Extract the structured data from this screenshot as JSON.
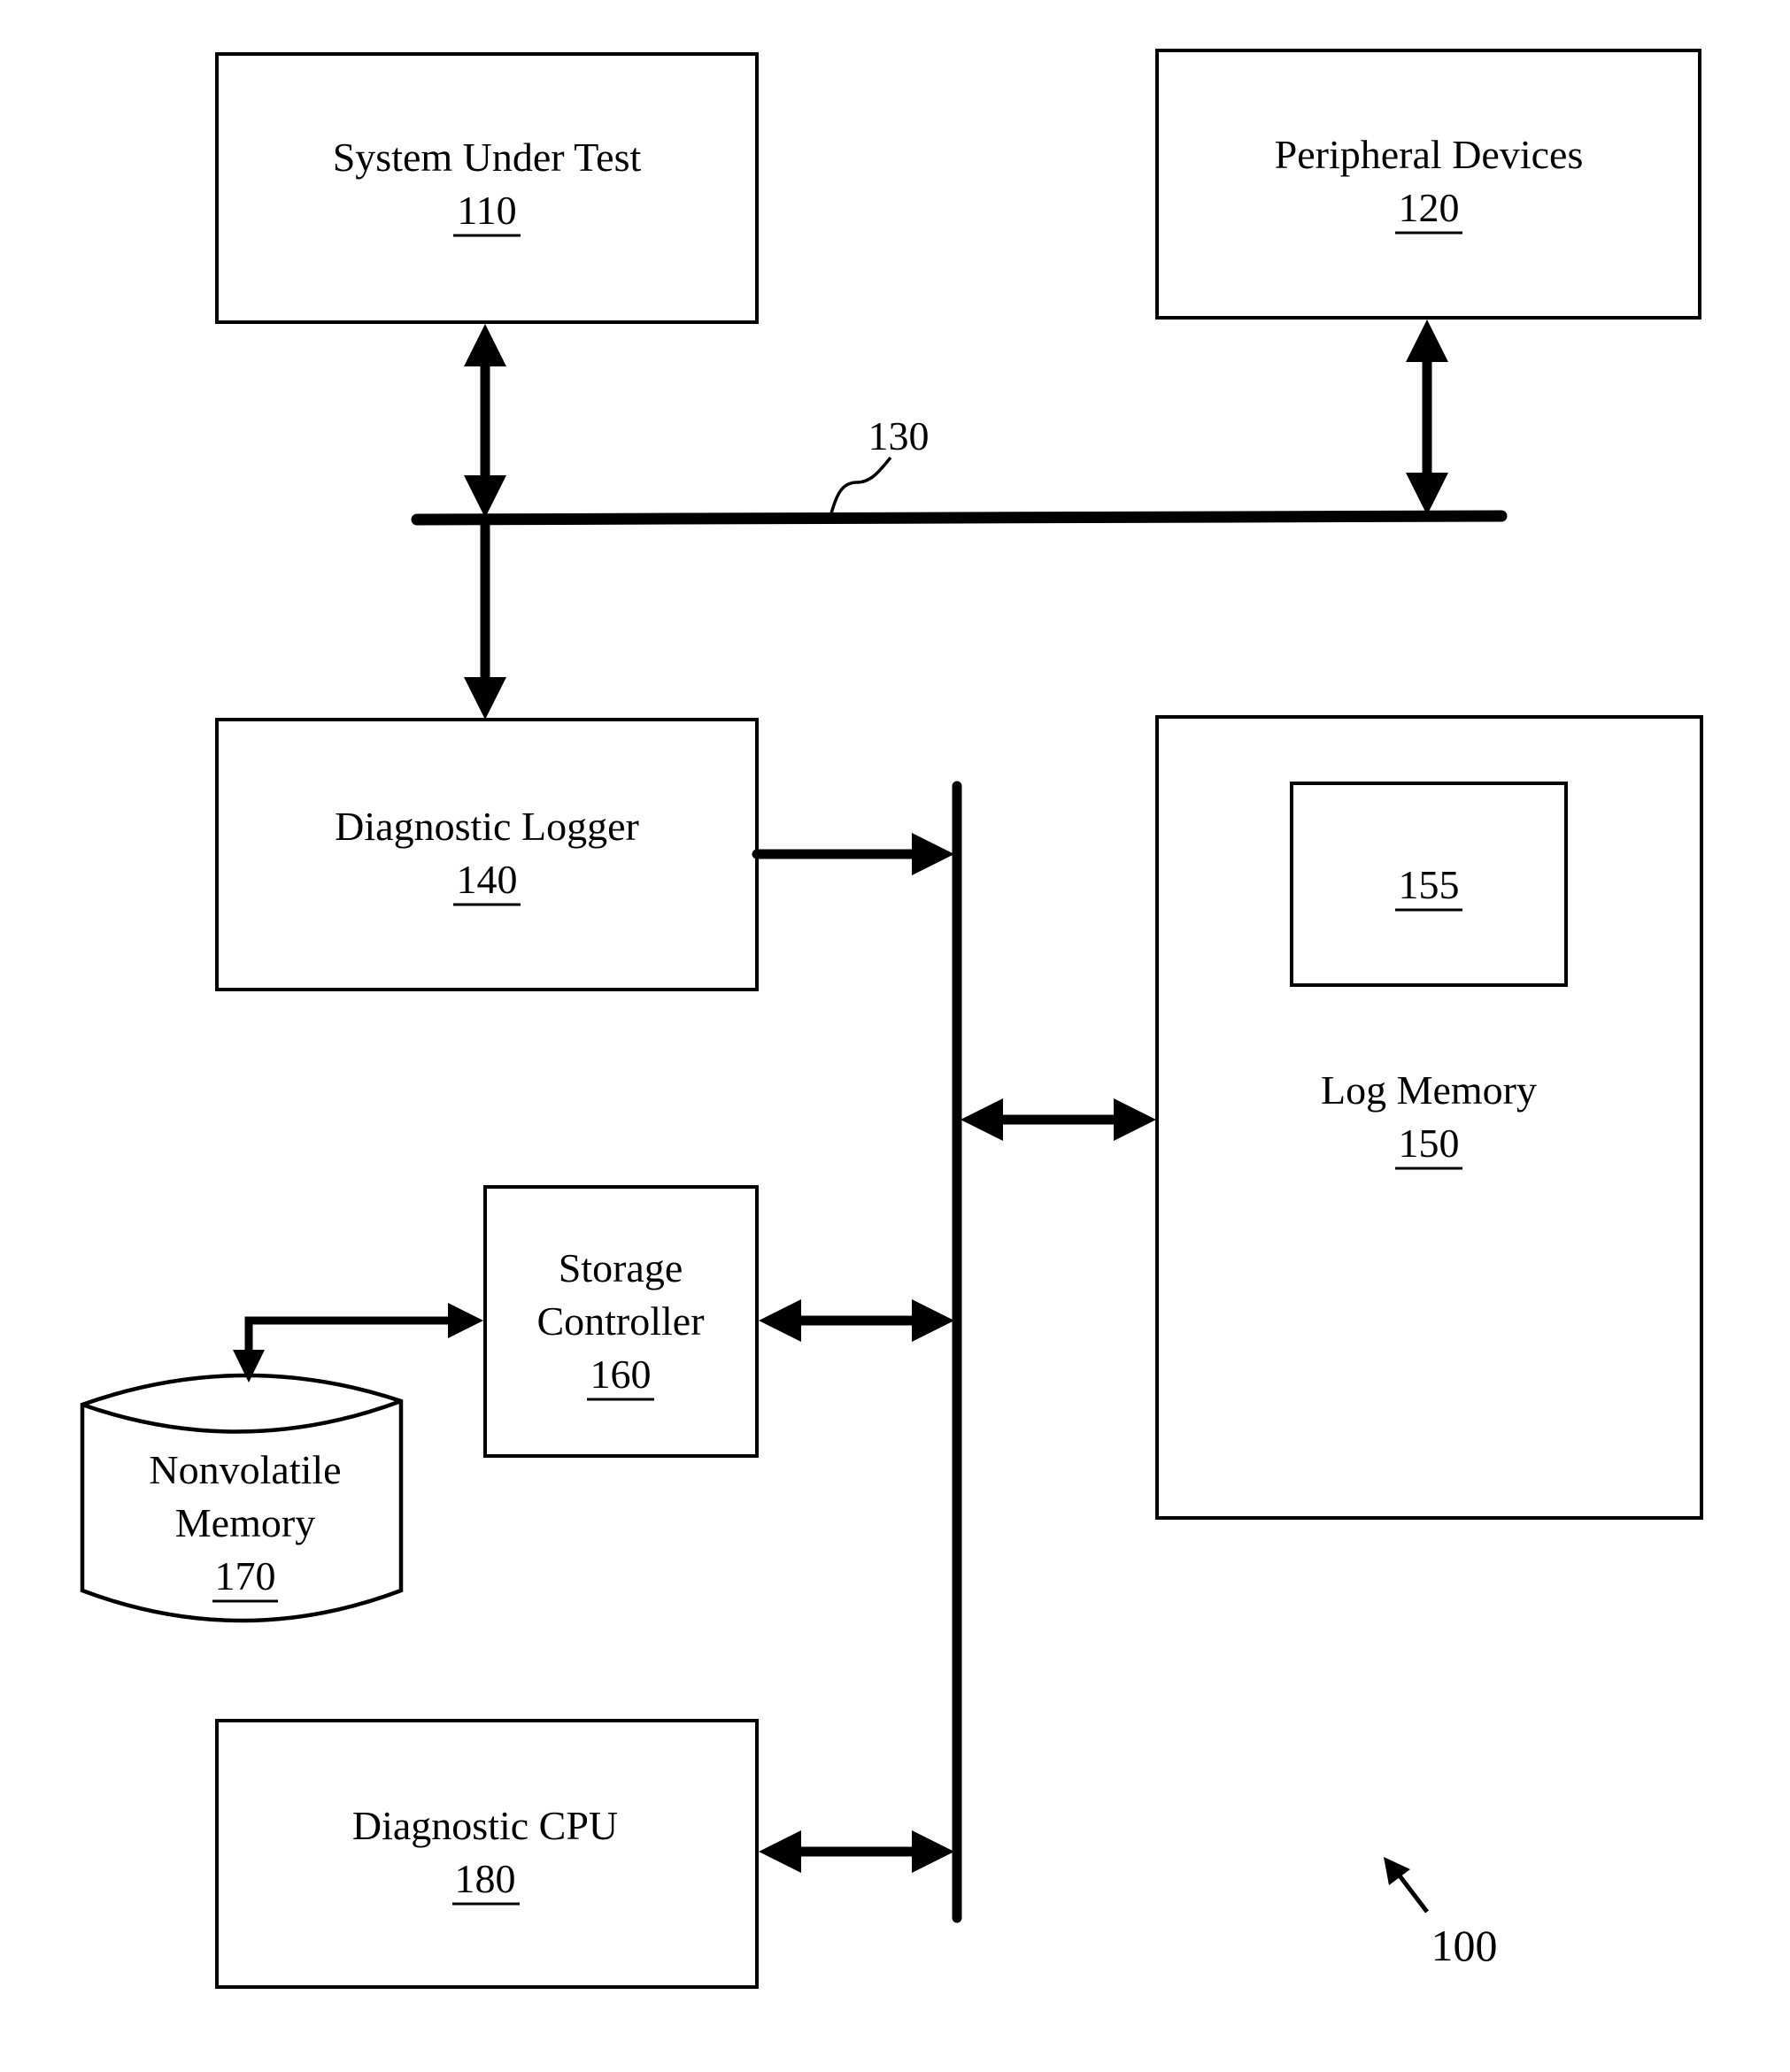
{
  "figure": {
    "reference": "100",
    "line_color": "#000000",
    "background": "#ffffff"
  },
  "blocks": {
    "system_under_test": {
      "title": "System Under Test",
      "ref": "110"
    },
    "peripheral_devices": {
      "title": "Peripheral Devices",
      "ref": "120"
    },
    "bus": {
      "ref": "130"
    },
    "diagnostic_logger": {
      "title": "Diagnostic Logger",
      "ref": "140"
    },
    "log_memory": {
      "title": "Log Memory",
      "ref": "150"
    },
    "log_memory_region": {
      "ref": "155"
    },
    "storage_controller": {
      "title_line1": "Storage",
      "title_line2": "Controller",
      "ref": "160"
    },
    "nonvolatile_memory": {
      "title_line1": "Nonvolatile",
      "title_line2": "Memory",
      "ref": "170"
    },
    "diagnostic_cpu": {
      "title": "Diagnostic CPU",
      "ref": "180"
    }
  },
  "connections": [
    {
      "from": "110",
      "to": "130",
      "direction": "bidirectional"
    },
    {
      "from": "120",
      "to": "130",
      "direction": "bidirectional"
    },
    {
      "from": "130",
      "to": "140",
      "direction": "unidirectional"
    },
    {
      "from": "140",
      "to": "internal-bus",
      "direction": "unidirectional"
    },
    {
      "from": "150",
      "to": "internal-bus",
      "direction": "bidirectional"
    },
    {
      "from": "160",
      "to": "internal-bus",
      "direction": "bidirectional"
    },
    {
      "from": "160",
      "to": "170",
      "direction": "bidirectional"
    },
    {
      "from": "180",
      "to": "internal-bus",
      "direction": "bidirectional"
    }
  ]
}
